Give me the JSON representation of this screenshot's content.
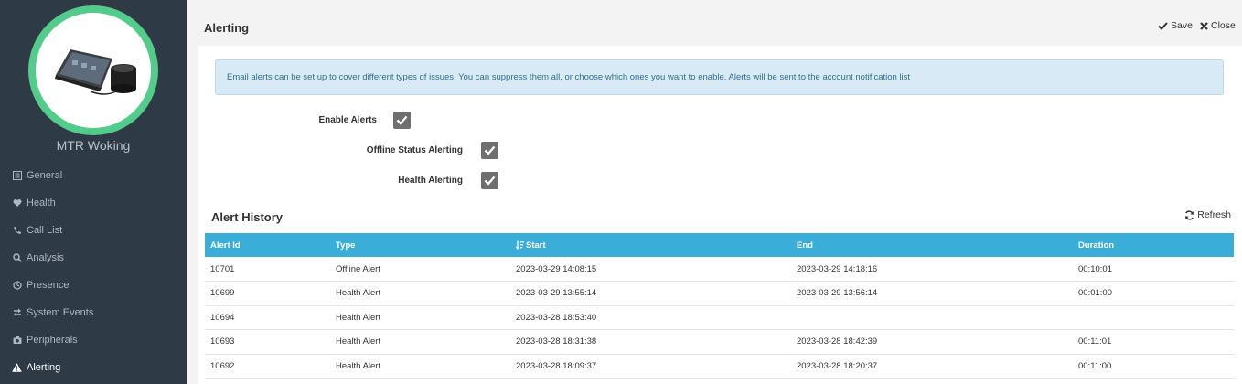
{
  "device": {
    "name": "MTR Woking"
  },
  "sidebar": {
    "items": [
      {
        "label": "General",
        "icon": "list-icon",
        "active": false
      },
      {
        "label": "Health",
        "icon": "heart-icon",
        "active": false
      },
      {
        "label": "Call List",
        "icon": "phone-icon",
        "active": false
      },
      {
        "label": "Analysis",
        "icon": "search-icon",
        "active": false
      },
      {
        "label": "Presence",
        "icon": "clock-icon",
        "active": false
      },
      {
        "label": "System Events",
        "icon": "exchange-icon",
        "active": false
      },
      {
        "label": "Peripherals",
        "icon": "camera-icon",
        "active": false
      },
      {
        "label": "Alerting",
        "icon": "warning-icon",
        "active": true
      }
    ]
  },
  "header": {
    "title": "Alerting",
    "save_label": "Save",
    "close_label": "Close"
  },
  "info": {
    "text": "Email alerts can be set up to cover different types of issues. You can suppress them all, or choose which ones you want to enable. Alerts will be sent to the account notification list"
  },
  "options": {
    "enable_alerts": {
      "label": "Enable Alerts",
      "checked": true
    },
    "offline_status": {
      "label": "Offline Status Alerting",
      "checked": true
    },
    "health": {
      "label": "Health Alerting",
      "checked": true
    }
  },
  "history": {
    "title": "Alert History",
    "refresh_label": "Refresh",
    "columns": [
      "Alert Id",
      "Type",
      "Start",
      "End",
      "Duration"
    ],
    "rows": [
      [
        "10701",
        "Offline Alert",
        "2023-03-29 14:08:15",
        "2023-03-29 14:18:16",
        "00:10:01"
      ],
      [
        "10699",
        "Health Alert",
        "2023-03-29 13:55:14",
        "2023-03-29 13:56:14",
        "00:01:00"
      ],
      [
        "10694",
        "Health Alert",
        "2023-03-28 18:53:40",
        "",
        ""
      ],
      [
        "10693",
        "Health Alert",
        "2023-03-28 18:31:38",
        "2023-03-28 18:42:39",
        "00:11:01"
      ],
      [
        "10692",
        "Health Alert",
        "2023-03-28 18:09:37",
        "2023-03-28 18:20:37",
        "00:11:00"
      ]
    ]
  },
  "colors": {
    "sidebar_bg": "#2f3a47",
    "accent_ring": "#53cc8b",
    "table_header": "#3aaed8",
    "info_bg": "#d8eaf5",
    "checkbox": "#6f6f6f"
  }
}
